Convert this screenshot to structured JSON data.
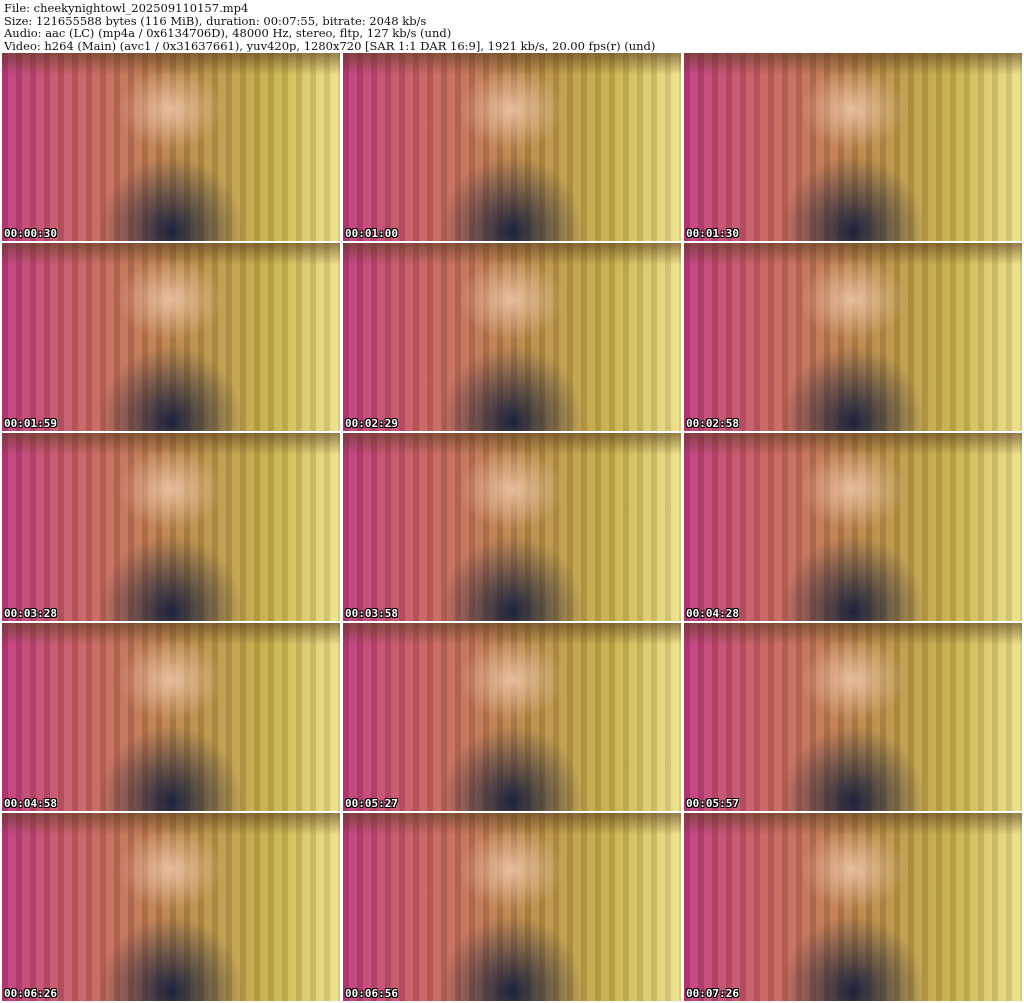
{
  "header": {
    "line1": "File: cheekynightowl_202509110157.mp4",
    "line2": "Size: 121655588 bytes (116 MiB), duration: 00:07:55, bitrate: 2048 kb/s",
    "line3": "Audio: aac (LC) (mp4a / 0x6134706D), 48000 Hz, stereo, fltp, 127 kb/s (und)",
    "line4": "Video: h264 (Main) (avc1 / 0x31637661), yuv420p, 1280x720 [SAR 1:1 DAR 16:9], 1921 kb/s, 20.00 fps(r) (und)"
  },
  "thumbnails": [
    {
      "time": "00:00:30"
    },
    {
      "time": "00:01:00"
    },
    {
      "time": "00:01:30"
    },
    {
      "time": "00:01:59"
    },
    {
      "time": "00:02:29"
    },
    {
      "time": "00:02:58"
    },
    {
      "time": "00:03:28"
    },
    {
      "time": "00:03:58"
    },
    {
      "time": "00:04:28"
    },
    {
      "time": "00:04:58"
    },
    {
      "time": "00:05:27"
    },
    {
      "time": "00:05:57"
    },
    {
      "time": "00:06:26"
    },
    {
      "time": "00:06:56"
    },
    {
      "time": "00:07:26"
    }
  ]
}
